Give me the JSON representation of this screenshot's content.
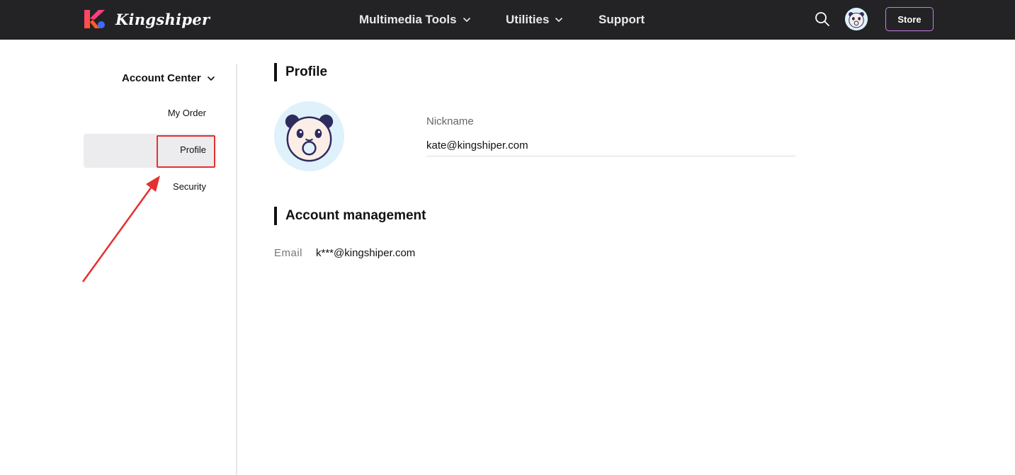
{
  "header": {
    "brand": "Kingshiper",
    "nav": [
      {
        "label": "Multimedia Tools",
        "has_dropdown": true
      },
      {
        "label": "Utilities",
        "has_dropdown": true
      },
      {
        "label": "Support",
        "has_dropdown": false
      }
    ],
    "search_icon": "search-icon",
    "store_label": "Store",
    "colors": {
      "bar": "#232326",
      "store_border": "#c77ae6"
    }
  },
  "sidebar": {
    "title": "Account Center",
    "items": [
      {
        "label": "My Order",
        "active": false
      },
      {
        "label": "Profile",
        "active": true
      },
      {
        "label": "Security",
        "active": false
      }
    ]
  },
  "profile": {
    "title": "Profile",
    "nickname_label": "Nickname",
    "nickname_value": "kate@kingshiper.com"
  },
  "account": {
    "title": "Account management",
    "email_label": "Email",
    "email_value": "k***@kingshiper.com"
  },
  "annotation": {
    "color": "#e53030"
  }
}
